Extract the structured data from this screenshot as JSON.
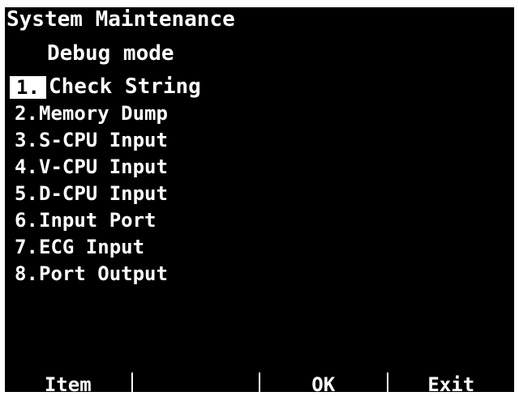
{
  "screen": {
    "title": "System Maintenance",
    "subtitle": "Debug mode"
  },
  "menu": {
    "selected_index": 0,
    "items": [
      {
        "number": "1.",
        "label": "Check String"
      },
      {
        "number": "2.",
        "label": "Memory Dump"
      },
      {
        "number": "3.",
        "label": "S-CPU Input"
      },
      {
        "number": "4.",
        "label": "V-CPU Input"
      },
      {
        "number": "5.",
        "label": "D-CPU Input"
      },
      {
        "number": "6.",
        "label": "Input Port"
      },
      {
        "number": "7.",
        "label": "ECG Input"
      },
      {
        "number": "8.",
        "label": "Port Output"
      }
    ]
  },
  "softkeys": [
    {
      "label": "Item"
    },
    {
      "label": ""
    },
    {
      "label": "OK"
    },
    {
      "label": "Exit"
    }
  ],
  "colors": {
    "background": "#000000",
    "foreground": "#ffffff",
    "highlight": "#ffffff"
  }
}
